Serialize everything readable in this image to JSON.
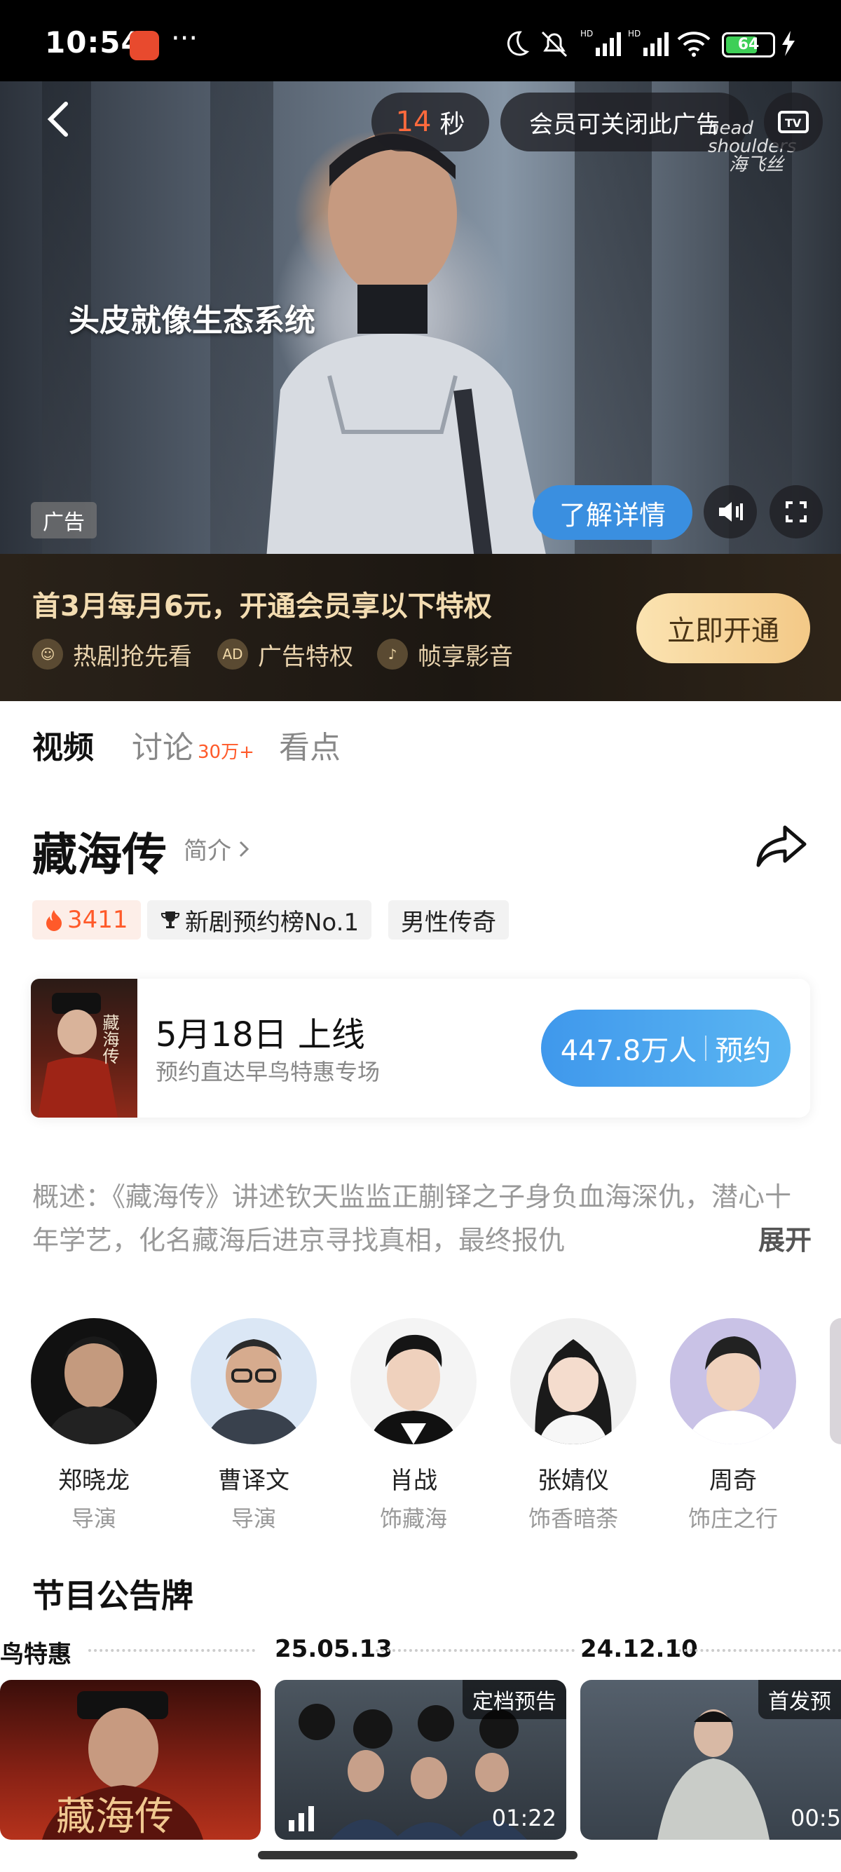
{
  "status": {
    "time": "10:54",
    "more": "···",
    "battery": "64"
  },
  "ad": {
    "subtitle": "头皮就像生态系统",
    "countdown_num": "14",
    "countdown_unit": "秒",
    "close_text": "会员可关闭此广告",
    "brand_line1": "head",
    "brand_line2": "shoulders",
    "brand_cn": "海飞丝",
    "tag": "广告",
    "learn_more": "了解详情"
  },
  "vip": {
    "title": "首3月每月6元，开通会员享以下特权",
    "perks": [
      {
        "icon": "drama-icon",
        "label": "热剧抢先看"
      },
      {
        "icon": "ad-icon",
        "label": "广告特权"
      },
      {
        "icon": "audio-icon",
        "label": "帧享影音"
      }
    ],
    "cta": "立即开通"
  },
  "tabs": {
    "video": "视频",
    "discuss": "讨论",
    "discuss_count": "30万+",
    "highlights": "看点"
  },
  "show": {
    "title": "藏海传",
    "intro": "简介",
    "tags": [
      "3411",
      "新剧预约榜No.1",
      "男性传奇"
    ],
    "poster_text": "藏海传"
  },
  "release": {
    "date": "5月18日 上线",
    "sub": "预约直达早鸟特惠专场",
    "count": "447.8万人",
    "reserve": "预约"
  },
  "synopsis": {
    "text": "概述：《藏海传》讲述钦天监监正蒯铎之子身负血海深仇，潜心十年学艺，化名藏海后进京寻找真相，最终报仇",
    "expand": "展开"
  },
  "cast": [
    {
      "name": "郑晓龙",
      "role": "导演"
    },
    {
      "name": "曹译文",
      "role": "导演"
    },
    {
      "name": "肖战",
      "role": "饰藏海"
    },
    {
      "name": "张婧仪",
      "role": "饰香暗荼"
    },
    {
      "name": "周奇",
      "role": "饰庄之行"
    }
  ],
  "bulletin": {
    "title": "节目公告牌",
    "timeline": [
      "鸟特惠",
      "25.05.13",
      "24.12.10"
    ],
    "items": [
      {
        "caption": "藏海传",
        "badge": "",
        "duration": ""
      },
      {
        "caption": "",
        "badge": "定档预告",
        "duration": "01:22"
      },
      {
        "caption": "",
        "badge": "首发预",
        "duration": "00:5"
      }
    ]
  }
}
